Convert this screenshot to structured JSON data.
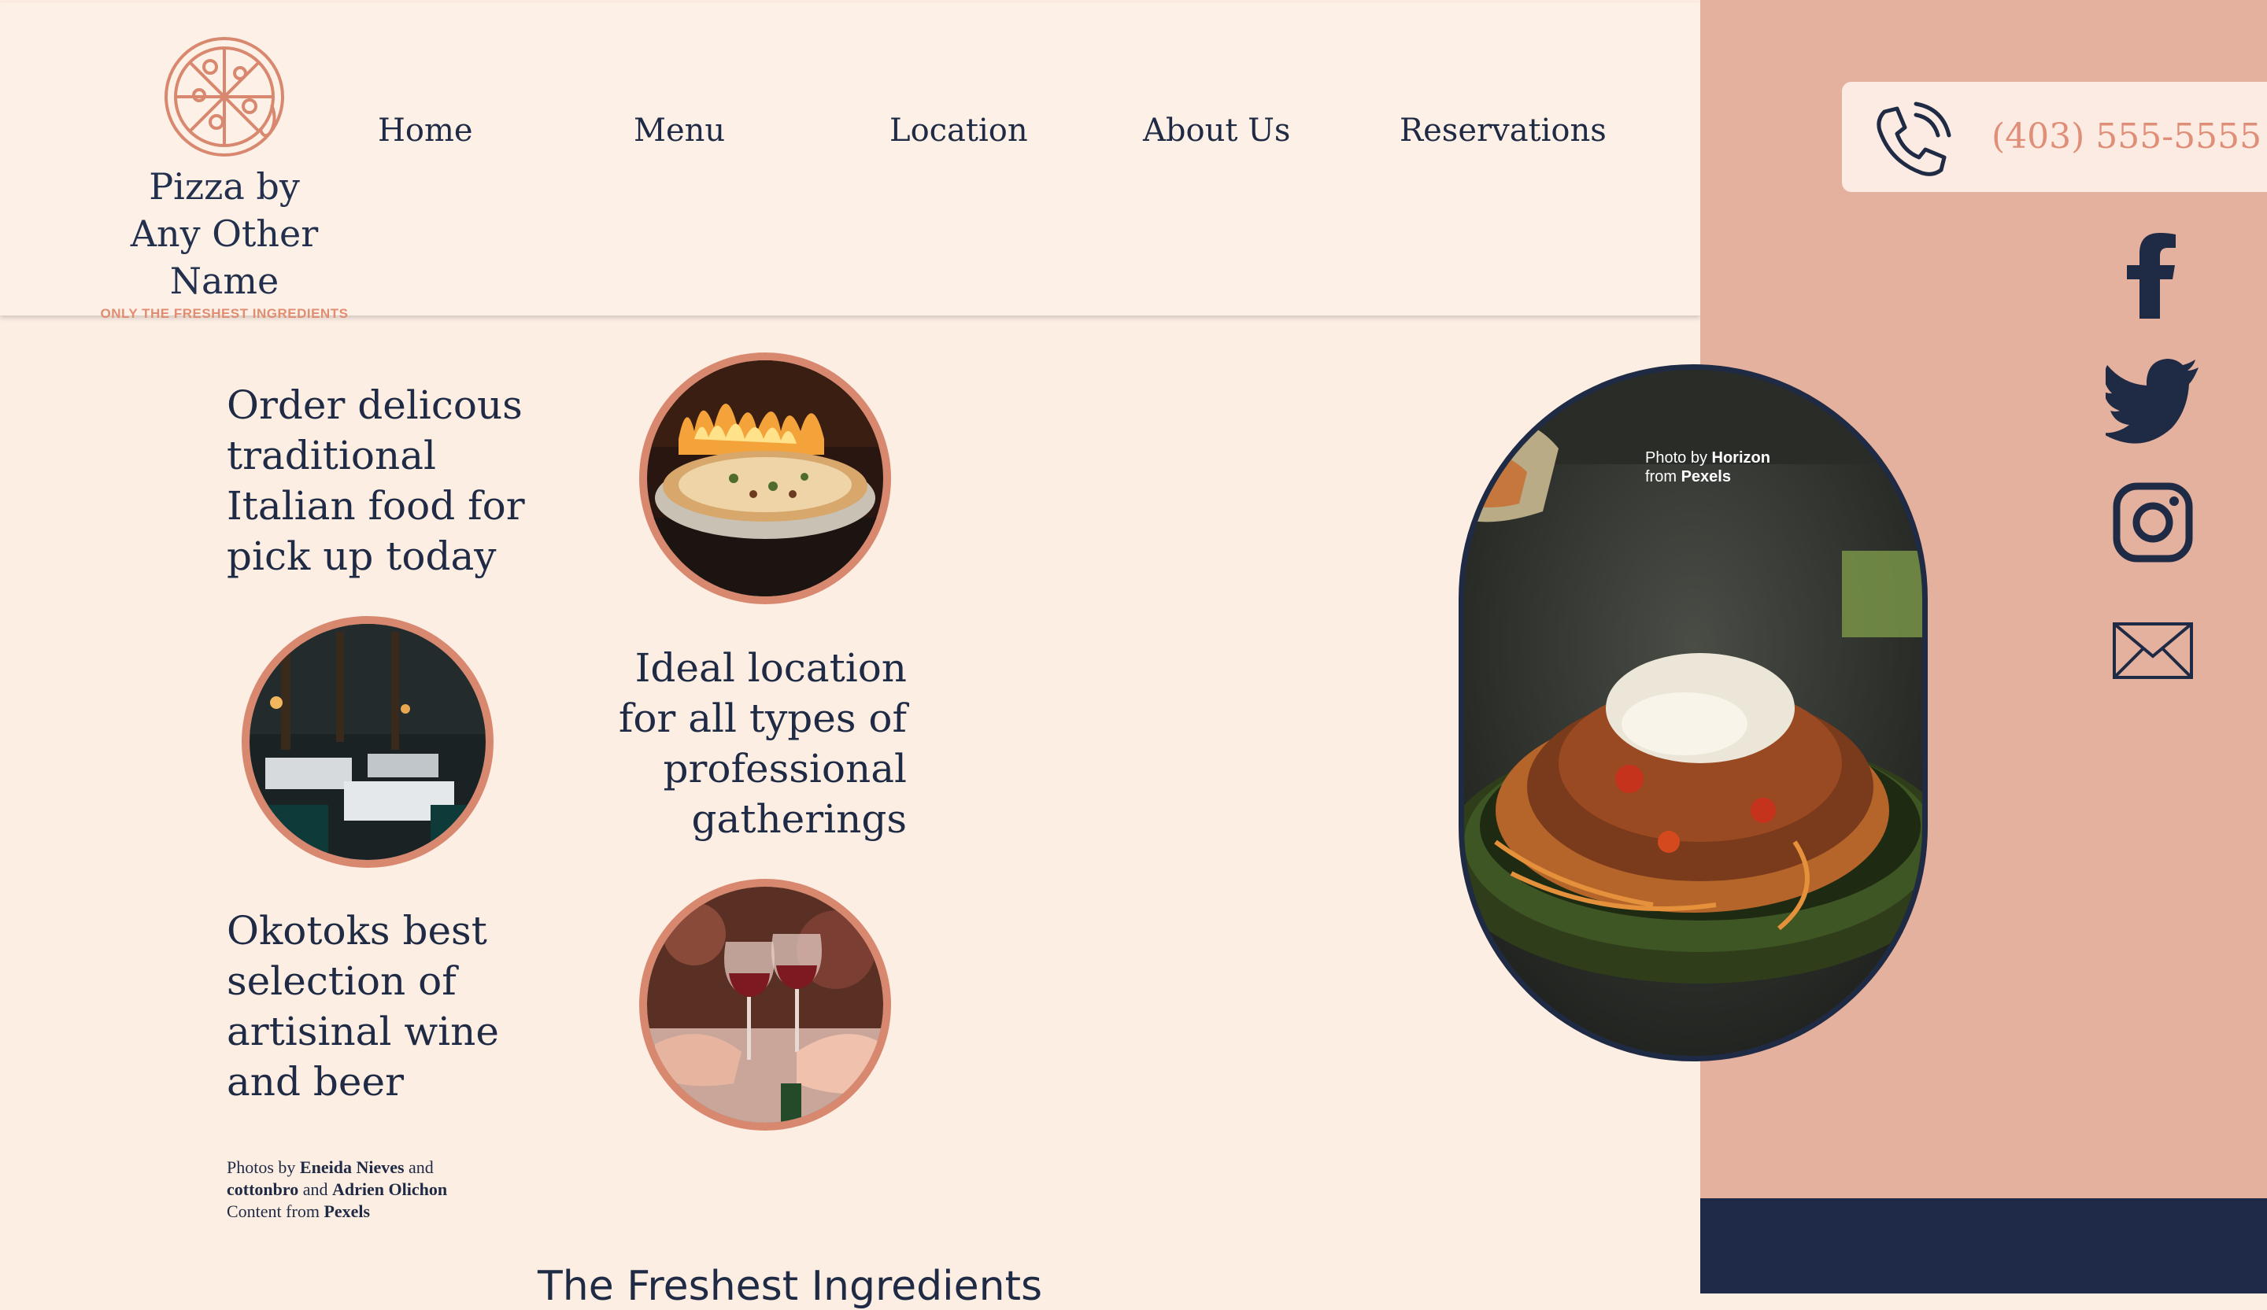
{
  "brand": {
    "name_line1": "Pizza by",
    "name_line2": "Any Other Name",
    "tagline": "ONLY THE FRESHEST INGREDIENTS",
    "logo_icon": "pizza-logo-icon"
  },
  "nav": {
    "items": [
      {
        "label": "Home"
      },
      {
        "label": "Menu"
      },
      {
        "label": "Location"
      },
      {
        "label": "About Us"
      },
      {
        "label": "Reservations"
      }
    ]
  },
  "contact": {
    "phone": "(403) 555-5555",
    "phone_icon": "phone-icon"
  },
  "social": {
    "icons": [
      "facebook-icon",
      "twitter-icon",
      "instagram-icon",
      "email-icon"
    ]
  },
  "features": {
    "order_text": "Order delicous traditional Italian food for pick up today",
    "location_text": "Ideal location for all types of professional gatherings",
    "wine_text": "Okotoks best selection of artisinal wine and beer"
  },
  "photo_credits": {
    "line1_prefix": "Photos by ",
    "name1": "Eneida Nieves",
    "and1": " and",
    "name2": "cottonbro",
    "and2": " and ",
    "name3": "Adrien Olichon",
    "content_prefix": "Content from ",
    "source": "Pexels"
  },
  "hero_photo": {
    "credit_prefix": "Photo by ",
    "photographer": "Horizon",
    "from_prefix": "from ",
    "source": "Pexels"
  },
  "section": {
    "heading": "The Freshest Ingredients"
  },
  "colors": {
    "background": "#fdeee4",
    "accent": "#d98870",
    "side_panel": "#e5b19f",
    "navy": "#1f2a44"
  }
}
